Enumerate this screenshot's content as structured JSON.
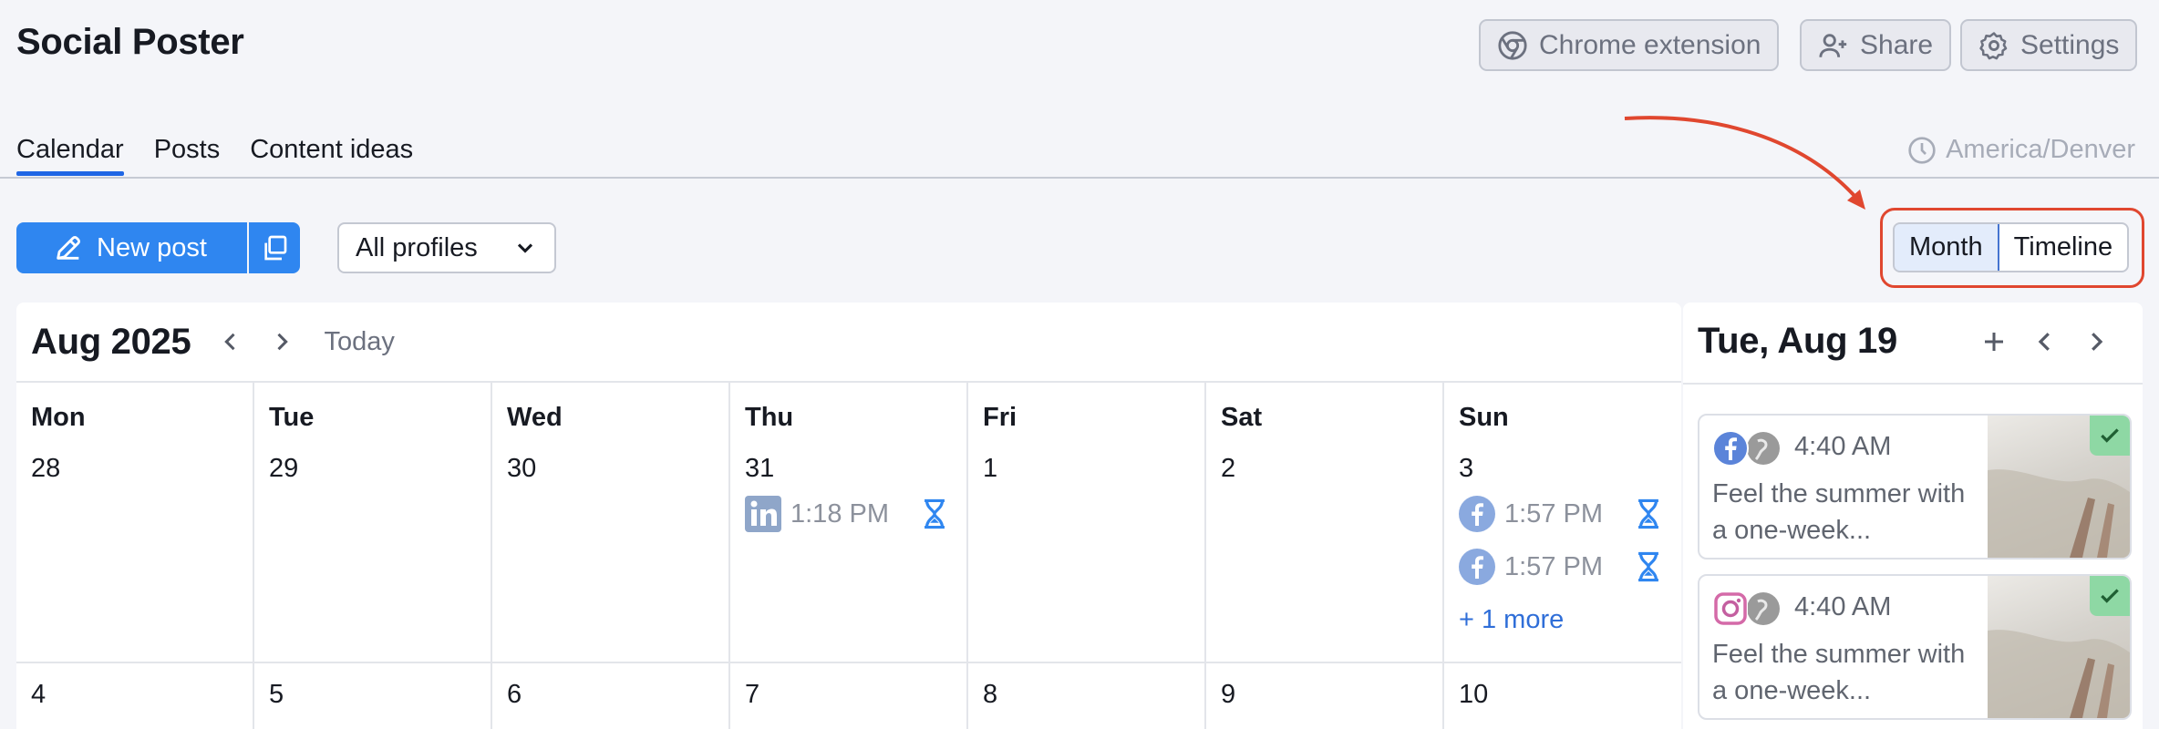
{
  "app": {
    "title": "Social Poster"
  },
  "header": {
    "chrome_extension_label": "Chrome extension",
    "share_label": "Share",
    "settings_label": "Settings"
  },
  "tabs": [
    {
      "label": "Calendar",
      "active": true
    },
    {
      "label": "Posts",
      "active": false
    },
    {
      "label": "Content ideas",
      "active": false
    }
  ],
  "timezone": "America/Denver",
  "toolbar": {
    "new_post_label": "New post",
    "profiles_selected": "All profiles",
    "view_options": [
      "Month",
      "Timeline"
    ],
    "view_selected": "Month"
  },
  "calendar": {
    "month_title": "Aug 2025",
    "today_label": "Today",
    "weekdays": [
      "Mon",
      "Tue",
      "Wed",
      "Thu",
      "Fri",
      "Sat",
      "Sun"
    ],
    "week1_days": [
      "28",
      "29",
      "30",
      "31",
      "1",
      "2",
      "3"
    ],
    "week2_days": [
      "4",
      "5",
      "6",
      "7",
      "8",
      "9",
      "10"
    ],
    "events": {
      "thu_31": [
        {
          "network": "linkedin",
          "time": "1:18 PM",
          "status": "hourglass-icon"
        }
      ],
      "sun_3": [
        {
          "network": "facebook",
          "time": "1:57 PM",
          "status": "hourglass-icon"
        },
        {
          "network": "facebook",
          "time": "1:57 PM",
          "status": "hourglass-icon"
        }
      ],
      "sun_3_more": "+ 1 more"
    }
  },
  "side_panel": {
    "date_title": "Tue, Aug 19",
    "posts": [
      {
        "network": "facebook",
        "time": "4:40 AM",
        "text": "Feel the summer with a one-week..."
      },
      {
        "network": "instagram",
        "time": "4:40 AM",
        "text": "Feel the summer with a one-week..."
      }
    ]
  },
  "colors": {
    "accent": "#2f86f0",
    "tab_underline": "#1f66e5",
    "highlight_annotation": "#e0472f",
    "pending_icon": "#2f86f0",
    "published_badge": "#8ed8a4"
  }
}
